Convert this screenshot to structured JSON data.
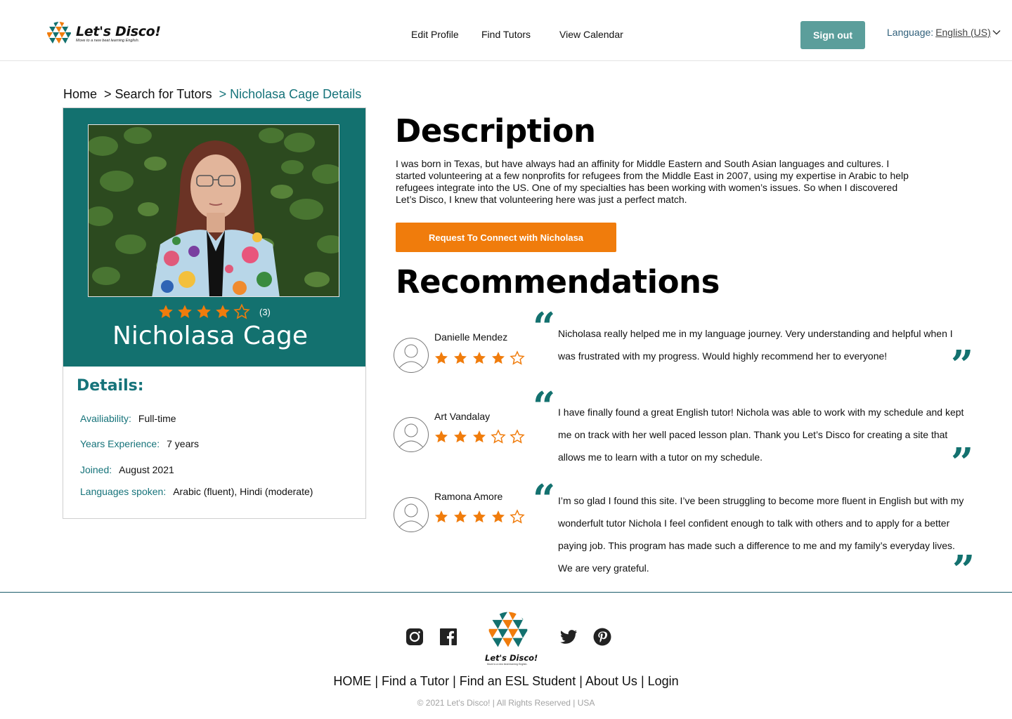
{
  "header": {
    "brand_name": "Let's Disco!",
    "brand_tagline": "Move to a new beat learning English.",
    "nav": [
      "Edit Profile",
      "Find Tutors",
      "View Calendar"
    ],
    "signout_label": "Sign out",
    "language_label": "Language:",
    "language_value": "English (US)"
  },
  "breadcrumb": {
    "home": "Home",
    "search": "> Search for Tutors",
    "current": "> Nicholasa Cage Details"
  },
  "profile": {
    "name": "Nicholasa Cage",
    "rating": 4,
    "rating_max": 5,
    "review_count": "(3)",
    "details_title": "Details:",
    "details": [
      {
        "label": "Availiability:",
        "value": "Full-time"
      },
      {
        "label": "Years Experience:",
        "value": "7 years"
      },
      {
        "label": "Joined:",
        "value": "August 2021"
      },
      {
        "label": "Languages spoken:",
        "value": "Arabic (fluent), Hindi (moderate)"
      }
    ]
  },
  "description": {
    "title": "Description",
    "text": "I was born in Texas, but have always had an affinity for Middle Eastern and South Asian languages and cultures. I started volunteering at a few nonprofits for refugees from the Middle East in 2007, using my expertise in Arabic to help refugees integrate into the US. One of my specialties has been working with women’s issues. So when I discovered Let’s Disco, I knew that volunteering here was just a perfect match.",
    "connect_label": "Request To Connect with Nicholasa"
  },
  "recommendations": {
    "title": "Recommendations",
    "items": [
      {
        "name": "Danielle Mendez",
        "rating": 4,
        "text": "Nicholasa really helped me in my language journey. Very understanding and helpful when I was frustrated with my progress. Would highly recommend her to everyone!"
      },
      {
        "name": "Art Vandalay",
        "rating": 3,
        "text": "I have finally found a great English tutor! Nichola was able to work with my schedule and kept me on track with her well paced lesson plan. Thank you Let’s Disco for creating a site that allows me to learn with a tutor on my schedule."
      },
      {
        "name": "Ramona Amore",
        "rating": 4,
        "text": "I’m so glad I found this site. I’ve been struggling to become more fluent in English but with my wonderfult tutor Nichola I feel confident enough to talk with others and to apply for a better paying job. This program has made such a difference to me and my family’s everyday lives. We are very grateful."
      }
    ]
  },
  "footer": {
    "social": [
      "instagram-icon",
      "facebook-icon",
      "twitter-icon",
      "pinterest-icon"
    ],
    "brand_name": "Let's Disco!",
    "brand_tagline": "Move to a new beat learning English.",
    "links": [
      "HOME",
      "Find a Tutor",
      "Find an ESL Student",
      "About Us",
      "Login"
    ],
    "copyright": "© 2021 Let's Disco! | All Rights Reserved  | USA"
  },
  "colors": {
    "teal": "#13716f",
    "orange": "#f07c0c",
    "signout": "#5b9e9b"
  }
}
